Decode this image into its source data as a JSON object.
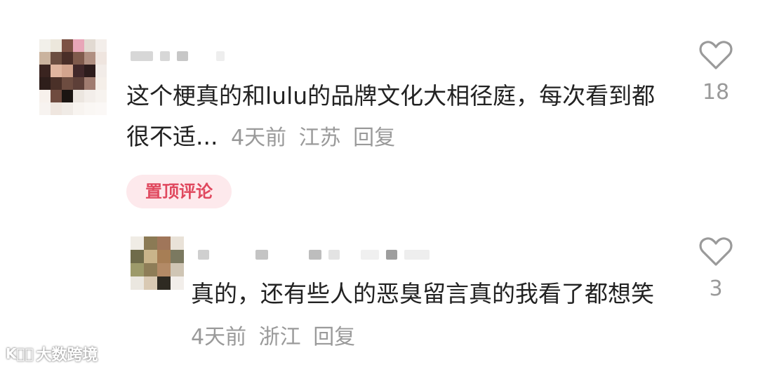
{
  "comments": [
    {
      "avatar_colors": [
        "#f2f0ea",
        "#ece7dc",
        "#7c5245",
        "#e8a6b8",
        "#e2dad2",
        "#f3eeea",
        "#cab39e",
        "#6b4d40",
        "#4a2e28",
        "#7f5a4c",
        "#b08f81",
        "#efe5df",
        "#3a2420",
        "#e0b59f",
        "#d3a48e",
        "#41282a",
        "#2d1c1c",
        "#f2ece8",
        "#2e1e1b",
        "#4a3028",
        "#6d4c40",
        "#5d3f38",
        "#a07c70",
        "#f5efe9",
        "#f7f1ec",
        "#6f4b3f",
        "#1b1512",
        "#ece6e0",
        "#f3eeea",
        "#f7f3ef",
        "#f7f3f0",
        "#efe6df",
        "#f0ebe6",
        "#f8f4f0",
        "#faf7f4",
        "#fbf8f6"
      ],
      "text": "这个梗真的和lulu的品牌文化大相径庭，每次看到都很不适...",
      "time": "4天前",
      "location": "江苏",
      "reply_label": "回复",
      "pinned_badge": "置顶评论",
      "likes": "18"
    },
    {
      "avatar_colors": [
        "#f0ece5",
        "#8b7a55",
        "#a0765a",
        "#e9e2d8",
        "#6f6b4a",
        "#c9b48a",
        "#a77e55",
        "#7b7960",
        "#9d9a6a",
        "#8e7d57",
        "#b38a66",
        "#cfc5b4",
        "#ebe7e0",
        "#d9c9b3",
        "#2e2a22",
        "#f2eeea"
      ],
      "text": "真的，还有些人的恶臭留言真的我看了都想笑",
      "time": "4天前",
      "location": "浙江",
      "reply_label": "回复",
      "likes": "3"
    }
  ],
  "icons": {
    "like": "heart-outline-icon"
  },
  "colors": {
    "badge_bg": "#fde9ec",
    "badge_text": "#e0485e",
    "meta": "#9a9a9a",
    "text": "#222222"
  },
  "watermark": {
    "logo": "K⃝⃝",
    "text": "大数跨境"
  }
}
